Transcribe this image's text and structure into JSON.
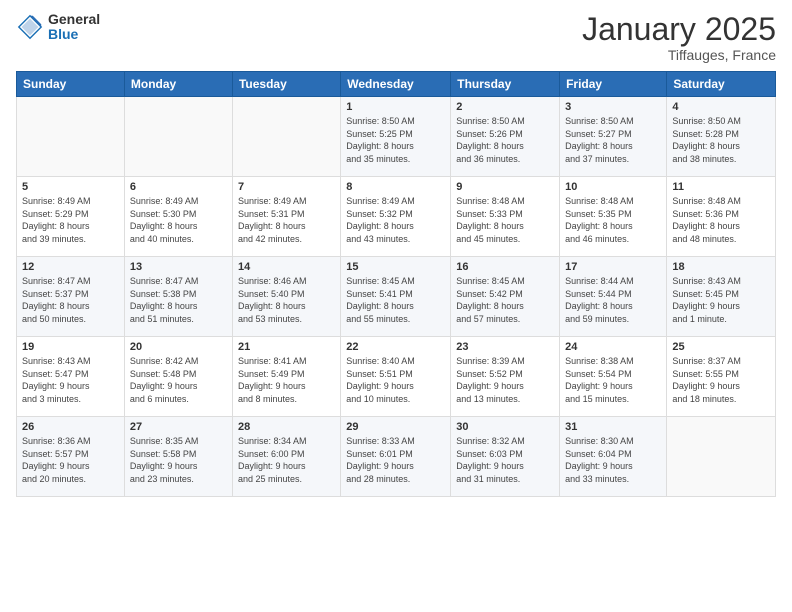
{
  "header": {
    "logo_general": "General",
    "logo_blue": "Blue",
    "month_title": "January 2025",
    "location": "Tiffauges, France"
  },
  "calendar": {
    "days_of_week": [
      "Sunday",
      "Monday",
      "Tuesday",
      "Wednesday",
      "Thursday",
      "Friday",
      "Saturday"
    ],
    "weeks": [
      [
        {
          "day": "",
          "info": ""
        },
        {
          "day": "",
          "info": ""
        },
        {
          "day": "",
          "info": ""
        },
        {
          "day": "1",
          "info": "Sunrise: 8:50 AM\nSunset: 5:25 PM\nDaylight: 8 hours\nand 35 minutes."
        },
        {
          "day": "2",
          "info": "Sunrise: 8:50 AM\nSunset: 5:26 PM\nDaylight: 8 hours\nand 36 minutes."
        },
        {
          "day": "3",
          "info": "Sunrise: 8:50 AM\nSunset: 5:27 PM\nDaylight: 8 hours\nand 37 minutes."
        },
        {
          "day": "4",
          "info": "Sunrise: 8:50 AM\nSunset: 5:28 PM\nDaylight: 8 hours\nand 38 minutes."
        }
      ],
      [
        {
          "day": "5",
          "info": "Sunrise: 8:49 AM\nSunset: 5:29 PM\nDaylight: 8 hours\nand 39 minutes."
        },
        {
          "day": "6",
          "info": "Sunrise: 8:49 AM\nSunset: 5:30 PM\nDaylight: 8 hours\nand 40 minutes."
        },
        {
          "day": "7",
          "info": "Sunrise: 8:49 AM\nSunset: 5:31 PM\nDaylight: 8 hours\nand 42 minutes."
        },
        {
          "day": "8",
          "info": "Sunrise: 8:49 AM\nSunset: 5:32 PM\nDaylight: 8 hours\nand 43 minutes."
        },
        {
          "day": "9",
          "info": "Sunrise: 8:48 AM\nSunset: 5:33 PM\nDaylight: 8 hours\nand 45 minutes."
        },
        {
          "day": "10",
          "info": "Sunrise: 8:48 AM\nSunset: 5:35 PM\nDaylight: 8 hours\nand 46 minutes."
        },
        {
          "day": "11",
          "info": "Sunrise: 8:48 AM\nSunset: 5:36 PM\nDaylight: 8 hours\nand 48 minutes."
        }
      ],
      [
        {
          "day": "12",
          "info": "Sunrise: 8:47 AM\nSunset: 5:37 PM\nDaylight: 8 hours\nand 50 minutes."
        },
        {
          "day": "13",
          "info": "Sunrise: 8:47 AM\nSunset: 5:38 PM\nDaylight: 8 hours\nand 51 minutes."
        },
        {
          "day": "14",
          "info": "Sunrise: 8:46 AM\nSunset: 5:40 PM\nDaylight: 8 hours\nand 53 minutes."
        },
        {
          "day": "15",
          "info": "Sunrise: 8:45 AM\nSunset: 5:41 PM\nDaylight: 8 hours\nand 55 minutes."
        },
        {
          "day": "16",
          "info": "Sunrise: 8:45 AM\nSunset: 5:42 PM\nDaylight: 8 hours\nand 57 minutes."
        },
        {
          "day": "17",
          "info": "Sunrise: 8:44 AM\nSunset: 5:44 PM\nDaylight: 8 hours\nand 59 minutes."
        },
        {
          "day": "18",
          "info": "Sunrise: 8:43 AM\nSunset: 5:45 PM\nDaylight: 9 hours\nand 1 minute."
        }
      ],
      [
        {
          "day": "19",
          "info": "Sunrise: 8:43 AM\nSunset: 5:47 PM\nDaylight: 9 hours\nand 3 minutes."
        },
        {
          "day": "20",
          "info": "Sunrise: 8:42 AM\nSunset: 5:48 PM\nDaylight: 9 hours\nand 6 minutes."
        },
        {
          "day": "21",
          "info": "Sunrise: 8:41 AM\nSunset: 5:49 PM\nDaylight: 9 hours\nand 8 minutes."
        },
        {
          "day": "22",
          "info": "Sunrise: 8:40 AM\nSunset: 5:51 PM\nDaylight: 9 hours\nand 10 minutes."
        },
        {
          "day": "23",
          "info": "Sunrise: 8:39 AM\nSunset: 5:52 PM\nDaylight: 9 hours\nand 13 minutes."
        },
        {
          "day": "24",
          "info": "Sunrise: 8:38 AM\nSunset: 5:54 PM\nDaylight: 9 hours\nand 15 minutes."
        },
        {
          "day": "25",
          "info": "Sunrise: 8:37 AM\nSunset: 5:55 PM\nDaylight: 9 hours\nand 18 minutes."
        }
      ],
      [
        {
          "day": "26",
          "info": "Sunrise: 8:36 AM\nSunset: 5:57 PM\nDaylight: 9 hours\nand 20 minutes."
        },
        {
          "day": "27",
          "info": "Sunrise: 8:35 AM\nSunset: 5:58 PM\nDaylight: 9 hours\nand 23 minutes."
        },
        {
          "day": "28",
          "info": "Sunrise: 8:34 AM\nSunset: 6:00 PM\nDaylight: 9 hours\nand 25 minutes."
        },
        {
          "day": "29",
          "info": "Sunrise: 8:33 AM\nSunset: 6:01 PM\nDaylight: 9 hours\nand 28 minutes."
        },
        {
          "day": "30",
          "info": "Sunrise: 8:32 AM\nSunset: 6:03 PM\nDaylight: 9 hours\nand 31 minutes."
        },
        {
          "day": "31",
          "info": "Sunrise: 8:30 AM\nSunset: 6:04 PM\nDaylight: 9 hours\nand 33 minutes."
        },
        {
          "day": "",
          "info": ""
        }
      ]
    ]
  }
}
